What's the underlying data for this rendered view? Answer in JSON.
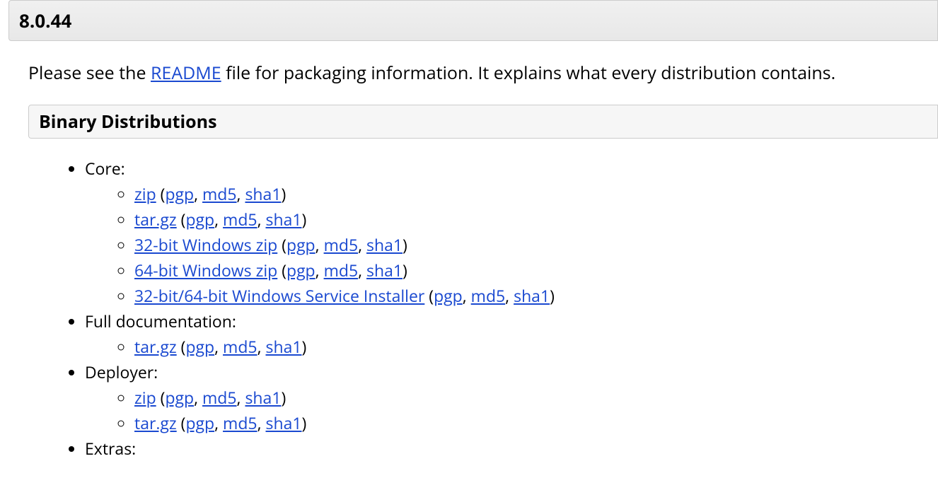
{
  "version": "8.0.44",
  "intro_prefix": "Please see the ",
  "intro_link": "README",
  "intro_suffix": " file for packaging information. It explains what every distribution contains.",
  "section_title": "Binary Distributions",
  "groups": [
    {
      "label": "Core:",
      "items": [
        {
          "name": "zip",
          "sigs": [
            "pgp",
            "md5",
            "sha1"
          ]
        },
        {
          "name": "tar.gz",
          "sigs": [
            "pgp",
            "md5",
            "sha1"
          ]
        },
        {
          "name": "32-bit Windows zip",
          "sigs": [
            "pgp",
            "md5",
            "sha1"
          ]
        },
        {
          "name": "64-bit Windows zip",
          "sigs": [
            "pgp",
            "md5",
            "sha1"
          ]
        },
        {
          "name": "32-bit/64-bit Windows Service Installer",
          "sigs": [
            "pgp",
            "md5",
            "sha1"
          ]
        }
      ]
    },
    {
      "label": "Full documentation:",
      "items": [
        {
          "name": "tar.gz",
          "sigs": [
            "pgp",
            "md5",
            "sha1"
          ]
        }
      ]
    },
    {
      "label": "Deployer:",
      "items": [
        {
          "name": "zip",
          "sigs": [
            "pgp",
            "md5",
            "sha1"
          ]
        },
        {
          "name": "tar.gz",
          "sigs": [
            "pgp",
            "md5",
            "sha1"
          ]
        }
      ]
    },
    {
      "label": "Extras:",
      "items": []
    }
  ]
}
